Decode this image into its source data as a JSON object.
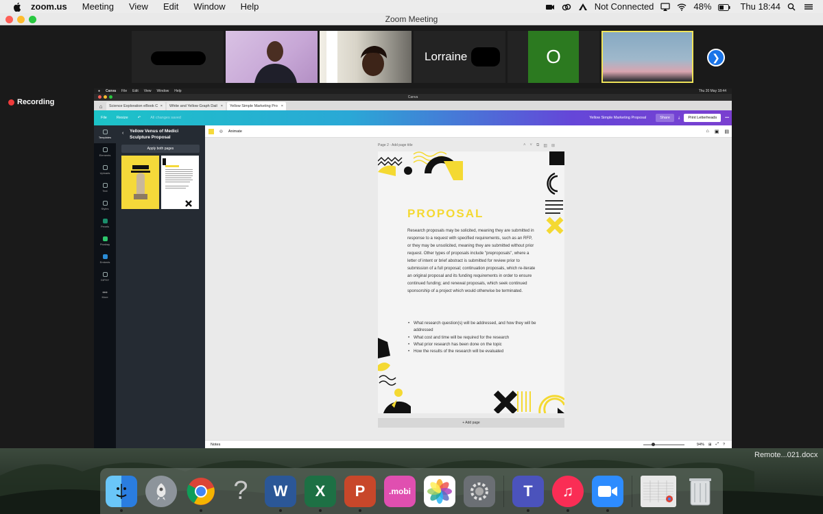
{
  "menubar": {
    "app_name": "zoom.us",
    "items": [
      "Meeting",
      "View",
      "Edit",
      "Window",
      "Help"
    ],
    "status": "Not Connected",
    "battery": "48%",
    "clock": "Thu 18:44"
  },
  "zoom": {
    "window_title": "Zoom Meeting",
    "recording_label": "Recording",
    "participants": [
      {
        "name": ""
      },
      {
        "name": ""
      },
      {
        "name": ""
      },
      {
        "name": "Lorraine"
      },
      {
        "name": "O"
      },
      {
        "name": ""
      }
    ]
  },
  "shared": {
    "mac_menubar": {
      "app": "Canva",
      "items": [
        "File",
        "Edit",
        "View",
        "Window",
        "Help"
      ],
      "clock": "Thu 20 May 18:44"
    },
    "window_title": "Canva",
    "tabs": [
      {
        "label": "Science Exploration eBook C",
        "active": false
      },
      {
        "label": "White and Yellow Graph Dail",
        "active": false
      },
      {
        "label": "Yellow Simple Marketing Pro",
        "active": true
      }
    ],
    "toolbar": {
      "file": "File",
      "resize": "Resize",
      "saved": "All changes saved",
      "doc_title": "Yellow Simple Marketing Proposal",
      "share": "Share",
      "print": "Print Letterheads"
    },
    "rail": [
      {
        "label": "Templates",
        "icon": "templates-icon"
      },
      {
        "label": "Elements",
        "icon": "elements-icon"
      },
      {
        "label": "Uploads",
        "icon": "uploads-icon"
      },
      {
        "label": "Text",
        "icon": "text-icon"
      },
      {
        "label": "Styles",
        "icon": "styles-icon"
      },
      {
        "label": "Pexels",
        "icon": "pexels-icon"
      },
      {
        "label": "Pixabay",
        "icon": "pixabay-icon"
      },
      {
        "label": "Embeds",
        "icon": "embeds-icon"
      },
      {
        "label": "GIPHY",
        "icon": "giphy-icon"
      },
      {
        "label": "More",
        "icon": "more-icon"
      }
    ],
    "panel": {
      "title": "Yellow Venus of Medici Sculpture Proposal",
      "apply": "Apply both pages"
    },
    "canvas": {
      "animate": "Animate",
      "page_label": "Page 2 - Add page title",
      "heading": "PROPOSAL",
      "body": "Research proposals may be solicited, meaning they are submitted in response to a request with specified requirements, such as an RFP, or they may be unsolicited, meaning they are submitted without prior request. Other types of proposals include \"preproposals\", where a letter of intent or brief abstract is submitted for review prior to submission of a full proposal; continuation proposals, which re-iterate an original proposal and its funding requirements in order to ensure continued funding; and renewal proposals, which seek continued sponsorship of a project which would otherwise be terminated.",
      "bullets": [
        "What research question(s) will be addressed, and how they will be addressed",
        "What cost and time will be required for the research",
        "What prior research has been done on the topic",
        "How the results of the research will be evaluated"
      ],
      "add_page": "+ Add page",
      "notes": "Notes",
      "zoom": "94%"
    }
  },
  "desktop": {
    "file_label": "Remote...021.docx"
  },
  "dock": [
    {
      "name": "finder",
      "color": "#2a8ff3",
      "glyph": ""
    },
    {
      "name": "launchpad",
      "color": "#9aa1a8",
      "glyph": ""
    },
    {
      "name": "chrome",
      "color": "#ffffff",
      "glyph": ""
    },
    {
      "name": "unknown",
      "color": "transparent",
      "glyph": "?"
    },
    {
      "name": "word",
      "color": "#2b5797",
      "glyph": "W"
    },
    {
      "name": "excel",
      "color": "#1d7044",
      "glyph": "X"
    },
    {
      "name": "powerpoint",
      "color": "#c8472a",
      "glyph": "P"
    },
    {
      "name": "mobi",
      "color": "#e04fb0",
      "glyph": ".mobi"
    },
    {
      "name": "photos",
      "color": "#ffffff",
      "glyph": ""
    },
    {
      "name": "system-preferences",
      "color": "#6b6f74",
      "glyph": ""
    },
    {
      "name": "teams",
      "color": "#4b53bc",
      "glyph": "T"
    },
    {
      "name": "music",
      "color": "#fa2d55",
      "glyph": "♫"
    },
    {
      "name": "zoom",
      "color": "#2d8cff",
      "glyph": ""
    },
    {
      "name": "spreadsheet-document",
      "color": "#e8e8e8",
      "glyph": ""
    },
    {
      "name": "trash",
      "color": "#d5d8da",
      "glyph": ""
    }
  ]
}
